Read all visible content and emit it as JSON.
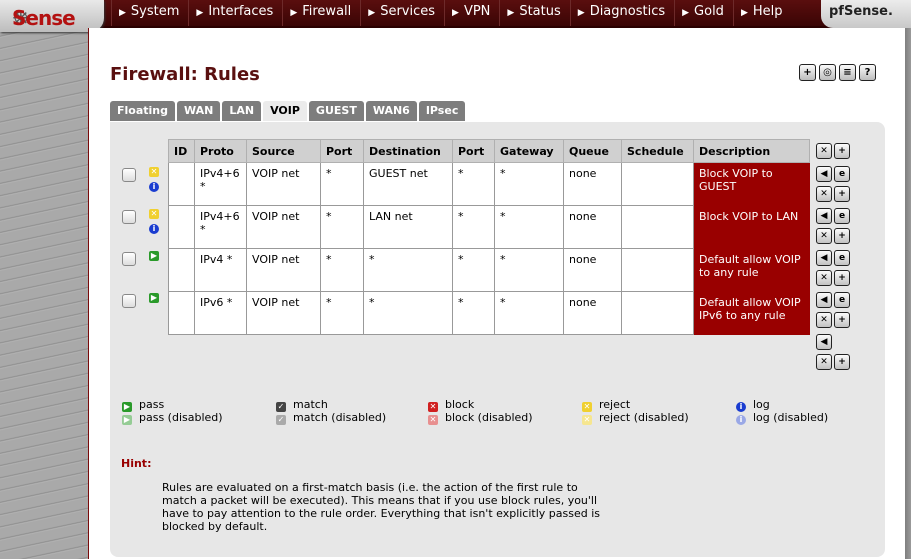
{
  "app": {
    "logo_main": "Sense",
    "brand": "pfSense."
  },
  "nav": [
    "System",
    "Interfaces",
    "Firewall",
    "Services",
    "VPN",
    "Status",
    "Diagnostics",
    "Gold",
    "Help"
  ],
  "page": {
    "title": "Firewall: Rules"
  },
  "tabs": [
    "Floating",
    "WAN",
    "LAN",
    "VOIP",
    "GUEST",
    "WAN6",
    "IPsec"
  ],
  "active_tab": "VOIP",
  "table": {
    "headers": [
      "ID",
      "Proto",
      "Source",
      "Port",
      "Destination",
      "Port",
      "Gateway",
      "Queue",
      "Schedule",
      "Description"
    ],
    "rows": [
      {
        "status": "reject",
        "log": true,
        "id": "",
        "proto": "IPv4+6 *",
        "source": "VOIP net",
        "sport": "*",
        "destination": "GUEST net",
        "dport": "*",
        "gateway": "*",
        "queue": "none",
        "schedule": "",
        "description": "Block VOIP to GUEST"
      },
      {
        "status": "reject",
        "log": true,
        "id": "",
        "proto": "IPv4+6 *",
        "source": "VOIP net",
        "sport": "*",
        "destination": "LAN net",
        "dport": "*",
        "gateway": "*",
        "queue": "none",
        "schedule": "",
        "description": "Block VOIP to LAN"
      },
      {
        "status": "pass",
        "log": false,
        "id": "",
        "proto": "IPv4 *",
        "source": "VOIP net",
        "sport": "*",
        "destination": "*",
        "dport": "*",
        "gateway": "*",
        "queue": "none",
        "schedule": "",
        "description": "Default allow VOIP to any rule"
      },
      {
        "status": "pass",
        "log": false,
        "id": "",
        "proto": "IPv6 *",
        "source": "VOIP net",
        "sport": "*",
        "destination": "*",
        "dport": "*",
        "gateway": "*",
        "queue": "none",
        "schedule": "",
        "description": "Default allow VOIP IPv6 to any rule"
      }
    ]
  },
  "legend": {
    "pass": "pass",
    "pass_disabled": "pass (disabled)",
    "match": "match",
    "match_disabled": "match (disabled)",
    "block": "block",
    "block_disabled": "block (disabled)",
    "reject": "reject",
    "reject_disabled": "reject (disabled)",
    "log": "log",
    "log_disabled": "log (disabled)"
  },
  "hint": {
    "label": "Hint:",
    "text": "Rules are evaluated on a first-match basis (i.e. the action of the first rule to match a packet will be executed). This means that if you use block rules, you'll have to pay attention to the rule order. Everything that isn't explicitly passed is blocked by default."
  },
  "colors": {
    "accent": "#990000",
    "header_bar": "#4a0a0a",
    "title": "#5a1010"
  }
}
